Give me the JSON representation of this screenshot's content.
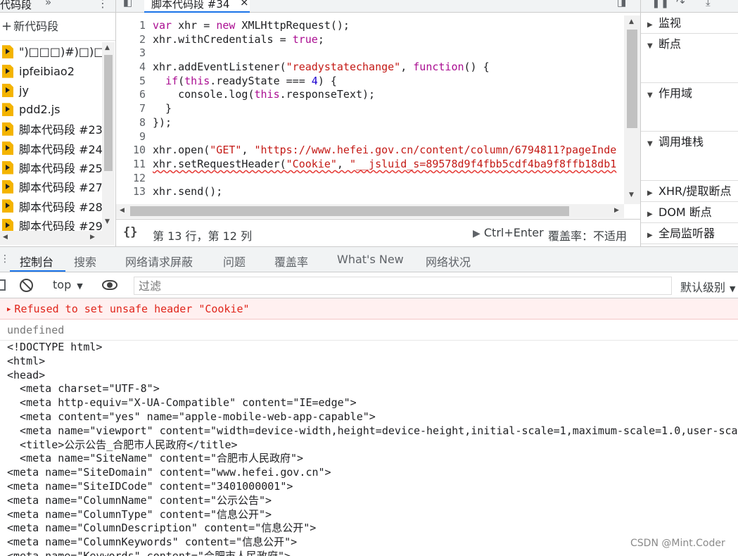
{
  "snippets": {
    "tab_label": "代码段",
    "more_tabs": "»",
    "kebab": "⋮",
    "new_snippet_label": "新代码段",
    "items": [
      {
        "name": "\")□□□)#)□)□□□)"
      },
      {
        "name": "ipfeibiao2"
      },
      {
        "name": "jy"
      },
      {
        "name": "pdd2.js"
      },
      {
        "name": "脚本代码段 #23"
      },
      {
        "name": "脚本代码段 #24"
      },
      {
        "name": "脚本代码段 #25"
      },
      {
        "name": "脚本代码段 #27"
      },
      {
        "name": "脚本代码段 #28"
      },
      {
        "name": "脚本代码段 #29"
      }
    ]
  },
  "editor": {
    "tab_label": "脚本代码段 #34",
    "tab_close": "×",
    "lines": [
      {
        "n": "1",
        "code": "var xhr = new XMLHttpRequest();"
      },
      {
        "n": "2",
        "code": "xhr.withCredentials = true;"
      },
      {
        "n": "3",
        "code": ""
      },
      {
        "n": "4",
        "code": "xhr.addEventListener(\"readystatechange\", function() {"
      },
      {
        "n": "5",
        "code": "  if(this.readyState === 4) {"
      },
      {
        "n": "6",
        "code": "    console.log(this.responseText);"
      },
      {
        "n": "7",
        "code": "  }"
      },
      {
        "n": "8",
        "code": "});"
      },
      {
        "n": "9",
        "code": ""
      },
      {
        "n": "10",
        "code": "xhr.open(\"GET\", \"https://www.hefei.gov.cn/content/column/6794811?pageInde"
      },
      {
        "n": "11",
        "code": "xhr.setRequestHeader(\"Cookie\", \"__jsluid_s=89578d9f4fbb5cdf4ba9f8ffb18db1"
      },
      {
        "n": "12",
        "code": ""
      },
      {
        "n": "13",
        "code": "xhr.send();"
      }
    ],
    "status": {
      "format": "{}",
      "cursor": "第 13 行，第 12 列",
      "run": "Ctrl+Enter",
      "coverage": "覆盖率：不适用"
    }
  },
  "debugger": {
    "sections": [
      {
        "label": "监视",
        "expanded": false
      },
      {
        "label": "断点",
        "expanded": true
      },
      {
        "label": "作用域",
        "expanded": true
      },
      {
        "label": "调用堆栈",
        "expanded": true
      },
      {
        "label": "XHR/提取断点",
        "expanded": false
      },
      {
        "label": "DOM 断点",
        "expanded": false
      },
      {
        "label": "全局监听器",
        "expanded": false
      }
    ]
  },
  "drawer": {
    "tabs": [
      {
        "label": "控制台",
        "active": true
      },
      {
        "label": "搜索"
      },
      {
        "label": "网络请求屏蔽"
      },
      {
        "label": "问题"
      },
      {
        "label": "覆盖率"
      },
      {
        "label": "What's New"
      },
      {
        "label": "网络状况"
      }
    ]
  },
  "console": {
    "context": "top",
    "filter_placeholder": "过滤",
    "levels": "默认级别",
    "error": "Refused to set unsafe header \"Cookie\"",
    "result": "undefined",
    "html_lines": [
      "<!DOCTYPE html>",
      "<html>",
      "<head>",
      "  <meta charset=\"UTF-8\">",
      "  <meta http-equiv=\"X-UA-Compatible\" content=\"IE=edge\">",
      "  <meta content=\"yes\" name=\"apple-mobile-web-app-capable\">",
      "  <meta name=\"viewport\" content=\"width=device-width,height=device-height,initial-scale=1,maximum-scale=1.0,user-sca",
      "  <title>公示公告_合肥市人民政府</title>",
      "  <meta name=\"SiteName\" content=\"合肥市人民政府\">",
      "<meta name=\"SiteDomain\" content=\"www.hefei.gov.cn\">",
      "<meta name=\"SiteIDCode\" content=\"3401000001\">",
      "<meta name=\"ColumnName\" content=\"公示公告\">",
      "<meta name=\"ColumnType\" content=\"信息公开\">",
      "<meta name=\"ColumnDescription\" content=\"信息公开\">",
      "<meta name=\"ColumnKeywords\" content=\"信息公开\">",
      "<meta name=\"Keywords\" content=\"合肥市人民政府\">"
    ]
  },
  "watermark": "CSDN @Mint.Coder",
  "colors": {
    "accent": "#1a73e8",
    "error_text": "#e0251b",
    "error_bg": "#fff0f0",
    "snippet_icon": "#f4b400"
  }
}
